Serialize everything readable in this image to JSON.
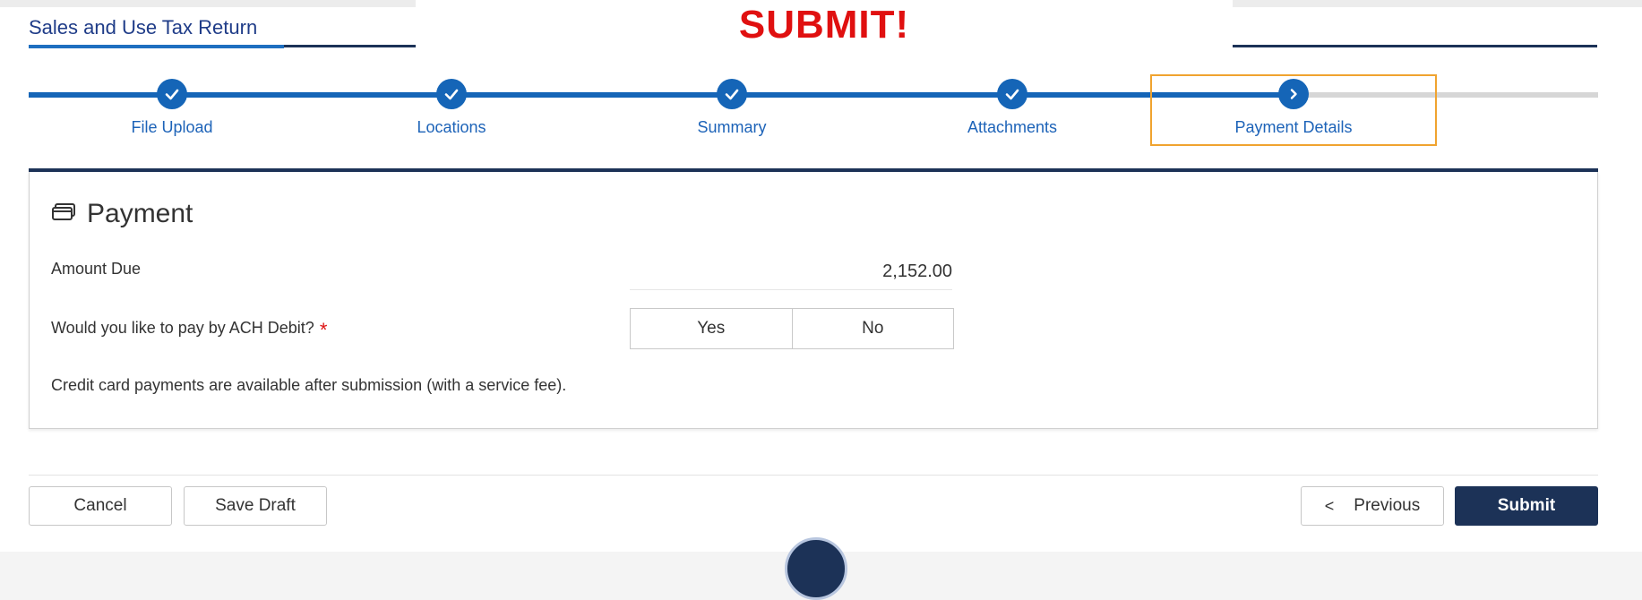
{
  "header": {
    "title": "Sales and Use Tax Return"
  },
  "banner": {
    "text": "SUBMIT!"
  },
  "stepper": {
    "steps": [
      {
        "label": "File Upload",
        "status": "complete",
        "icon": "check-icon"
      },
      {
        "label": "Locations",
        "status": "complete",
        "icon": "check-icon"
      },
      {
        "label": "Summary",
        "status": "complete",
        "icon": "check-icon"
      },
      {
        "label": "Attachments",
        "status": "complete",
        "icon": "check-icon"
      },
      {
        "label": "Payment Details",
        "status": "current",
        "icon": "chevron-right-icon"
      }
    ]
  },
  "payment": {
    "title": "Payment",
    "icon": "credit-card-icon",
    "amount_label": "Amount Due",
    "amount_value": "2,152.00",
    "ach_question": "Would you like to pay by ACH Debit?",
    "required_marker": "*",
    "yes_label": "Yes",
    "no_label": "No",
    "credit_note": "Credit card payments are available after submission (with a service fee)."
  },
  "footer": {
    "cancel_label": "Cancel",
    "save_draft_label": "Save Draft",
    "previous_label": "Previous",
    "previous_icon": "chevron-left-icon",
    "submit_label": "Submit"
  },
  "colors": {
    "brand_dark": "#1c3257",
    "step_blue": "#1565b7",
    "highlight_orange": "#f0a32f",
    "banner_red": "#e01010"
  }
}
